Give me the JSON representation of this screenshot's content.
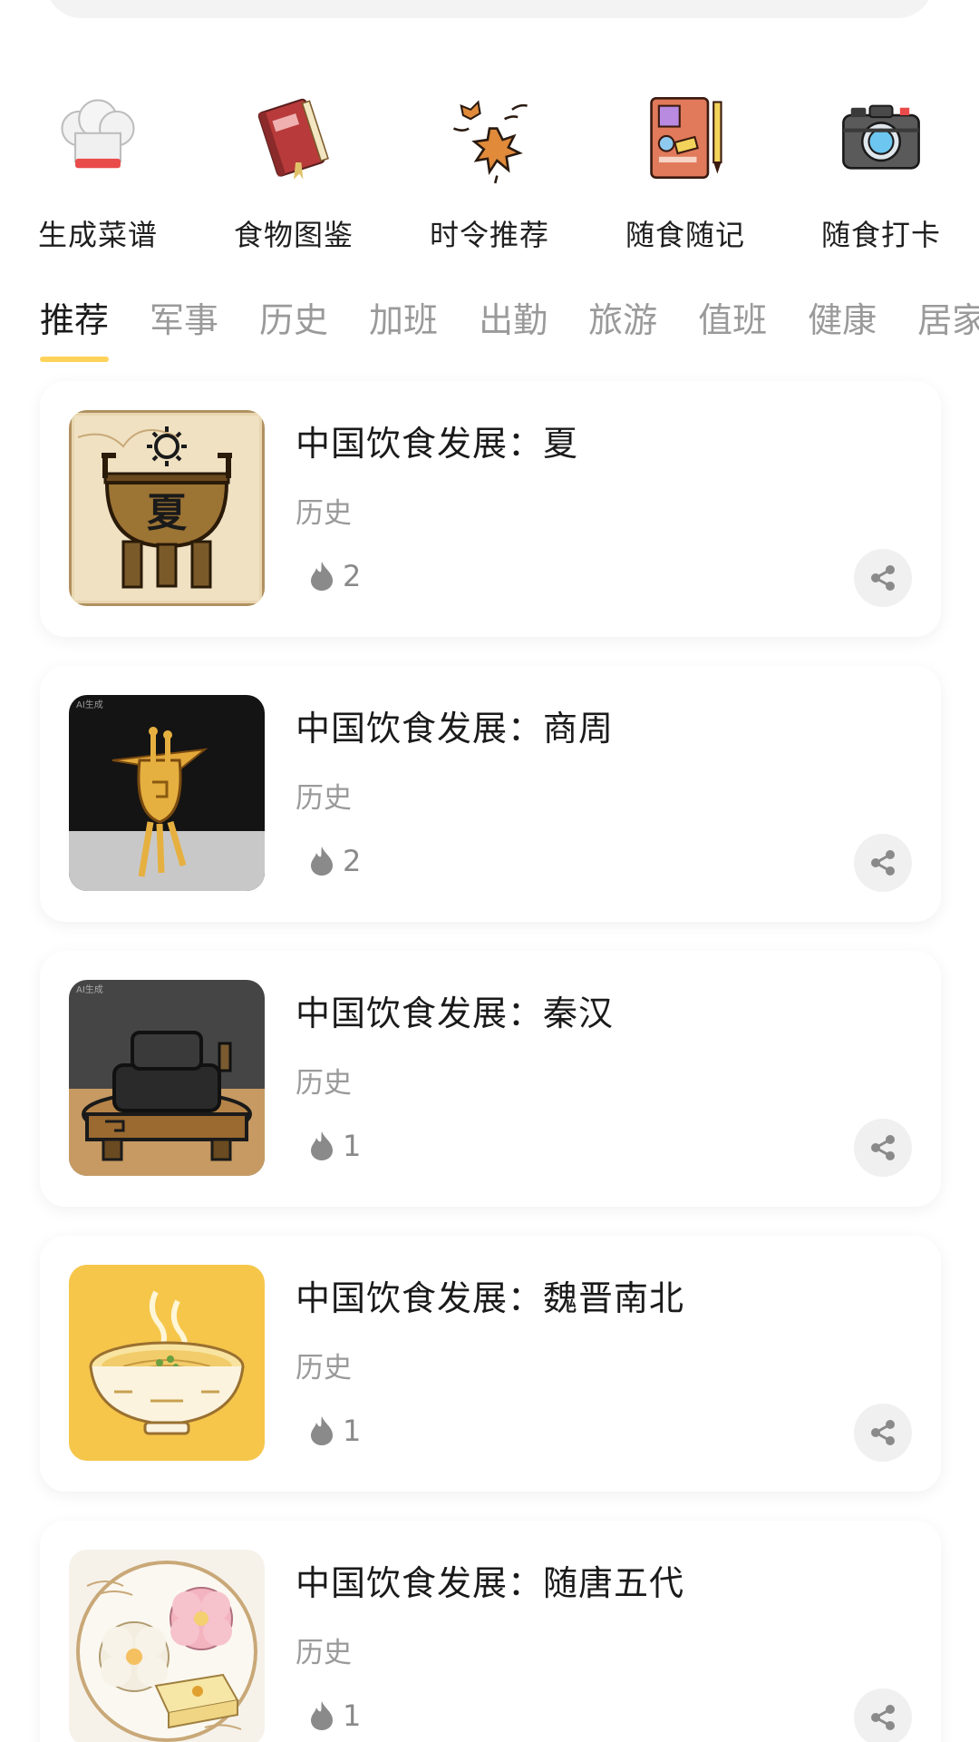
{
  "quick_entries": [
    {
      "label": "生成菜谱",
      "icon": "chef-hat-icon"
    },
    {
      "label": "食物图鉴",
      "icon": "book-icon"
    },
    {
      "label": "时令推荐",
      "icon": "maple-leaf-icon"
    },
    {
      "label": "随食随记",
      "icon": "notebook-pen-icon"
    },
    {
      "label": "随食打卡",
      "icon": "camera-icon"
    }
  ],
  "tabs": [
    "推荐",
    "军事",
    "历史",
    "加班",
    "出勤",
    "旅游",
    "值班",
    "健康",
    "居家"
  ],
  "active_tab": "推荐",
  "cards": [
    {
      "title": "中国饮食发展：夏",
      "tag": "历史",
      "hot": "2",
      "image": "xia-bronze-ding"
    },
    {
      "title": "中国饮食发展：商周",
      "tag": "历史",
      "hot": "2",
      "image": "shang-zhou-jue-vessel"
    },
    {
      "title": "中国饮食发展：秦汉",
      "tag": "历史",
      "hot": "1",
      "image": "qin-han-stone-mill"
    },
    {
      "title": "中国饮食发展：魏晋南北",
      "tag": "历史",
      "hot": "1",
      "image": "weijin-noodle-bowl"
    },
    {
      "title": "中国饮食发展：随唐五代",
      "tag": "历史",
      "hot": "1",
      "image": "sui-tang-pastries"
    }
  ],
  "thumb_badges": {
    "ai_label": "AI生成",
    "xia_character": "夏"
  },
  "colors": {
    "accent": "#ffd35a",
    "muted_text": "#9a9a9a",
    "card_bg": "#ffffff"
  }
}
